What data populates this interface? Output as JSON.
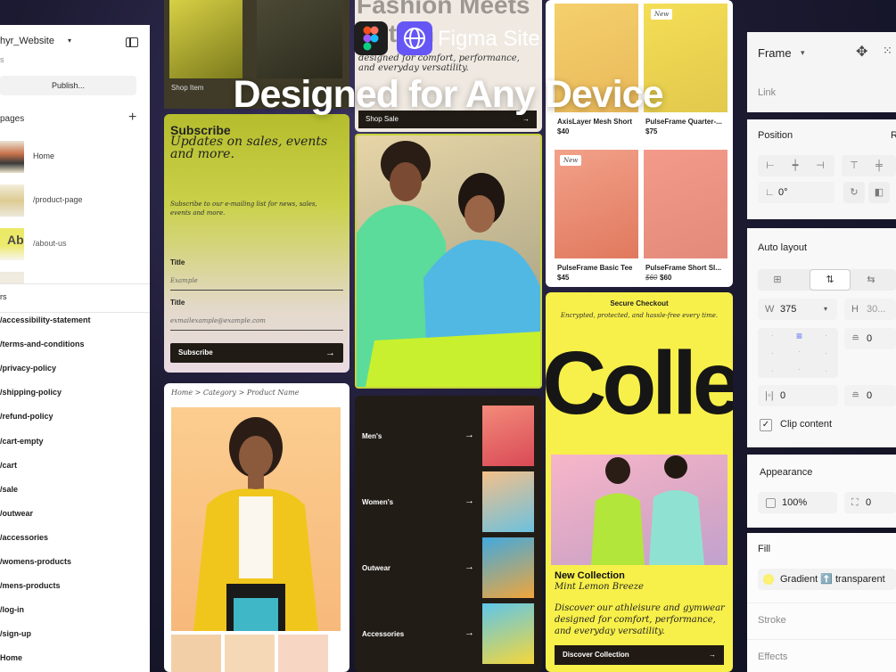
{
  "header": {
    "brand": "Figma Site",
    "headline": "Designed for Any Device"
  },
  "left_panel": {
    "project_title": "hyr_Website",
    "project_sub": "s",
    "publish_label": "Publish...",
    "pages_label": "pages",
    "pages": [
      {
        "name": "Home"
      },
      {
        "name": "/product-page"
      },
      {
        "name": "/about-us"
      }
    ],
    "layers_label": "rs",
    "routes": [
      "/accessibility-statement",
      "/terms-and-conditions",
      "/privacy-policy",
      "/shipping-policy",
      "/refund-policy",
      "/cart-empty",
      "/cart",
      "/sale",
      "/outwear",
      "/accessories",
      "/womens-products",
      "/mens-products",
      "/log-in",
      "/sign-up",
      "Home"
    ]
  },
  "cards": {
    "top_left": {
      "label": "Shop Item"
    },
    "subscribe": {
      "title": "Subscribe",
      "tagline": "Updates on sales, events and more.",
      "description": "Subscribe to our e-mailing list for news, sales, events and more.",
      "field1_label": "Title",
      "field1_placeholder": "Example",
      "field2_label": "Title",
      "field2_placeholder": "exmailexample@example.com",
      "button": "Subscribe",
      "arrow": "→"
    },
    "product": {
      "breadcrumb": "Home  >  Category  >  Product Name"
    },
    "hero": {
      "title": "Fashion Meets Action",
      "tagline": "designed for comfort, performance, and everyday versatility.",
      "button": "Shop Sale",
      "arrow": "→"
    },
    "categories": [
      {
        "label": "Men's",
        "arrow": "→"
      },
      {
        "label": "Women's",
        "arrow": "→"
      },
      {
        "label": "Outwear",
        "arrow": "→"
      },
      {
        "label": "Accessories",
        "arrow": "→"
      }
    ],
    "shop": {
      "items": [
        {
          "name": "AxisLayer Mesh Short",
          "price": "$40"
        },
        {
          "name": "PulseFrame Quarter-...",
          "price": "$75",
          "badge": "New"
        },
        {
          "name": "PulseFrame Basic Tee",
          "price": "$45",
          "badge": "New"
        },
        {
          "name": "PulseFrame Short Sl...",
          "old_price": "$60",
          "price": "$60"
        }
      ]
    },
    "checkout": {
      "title": "Secure Checkout",
      "subtitle": "Encrypted, protected, and hassle-free every time.",
      "big_word": "Colle",
      "collection_title": "New Collection",
      "collection_sub": "Mint Lemon Breeze",
      "description": "Discover our athleisure and gymwear designed for comfort, performance, and everyday versatility.",
      "button": "Discover Collection",
      "arrow": "→"
    }
  },
  "right_panel": {
    "frame_label": "Frame",
    "link_label": "Link",
    "position_label": "Position",
    "position_extra": "R",
    "rotation": "0°",
    "auto_layout_label": "Auto layout",
    "width_prefix": "W",
    "width_value": "375",
    "height_prefix": "H",
    "height_value": "30...",
    "padding_v": "0",
    "gap": "0",
    "padding_h": "0",
    "clip_label": "Clip content",
    "appearance_label": "Appearance",
    "opacity": "100%",
    "radius": "0",
    "fill_label": "Fill",
    "fill_value": "Gradient ⬆️ transparent",
    "stroke_label": "Stroke",
    "effects_label": "Effects"
  }
}
